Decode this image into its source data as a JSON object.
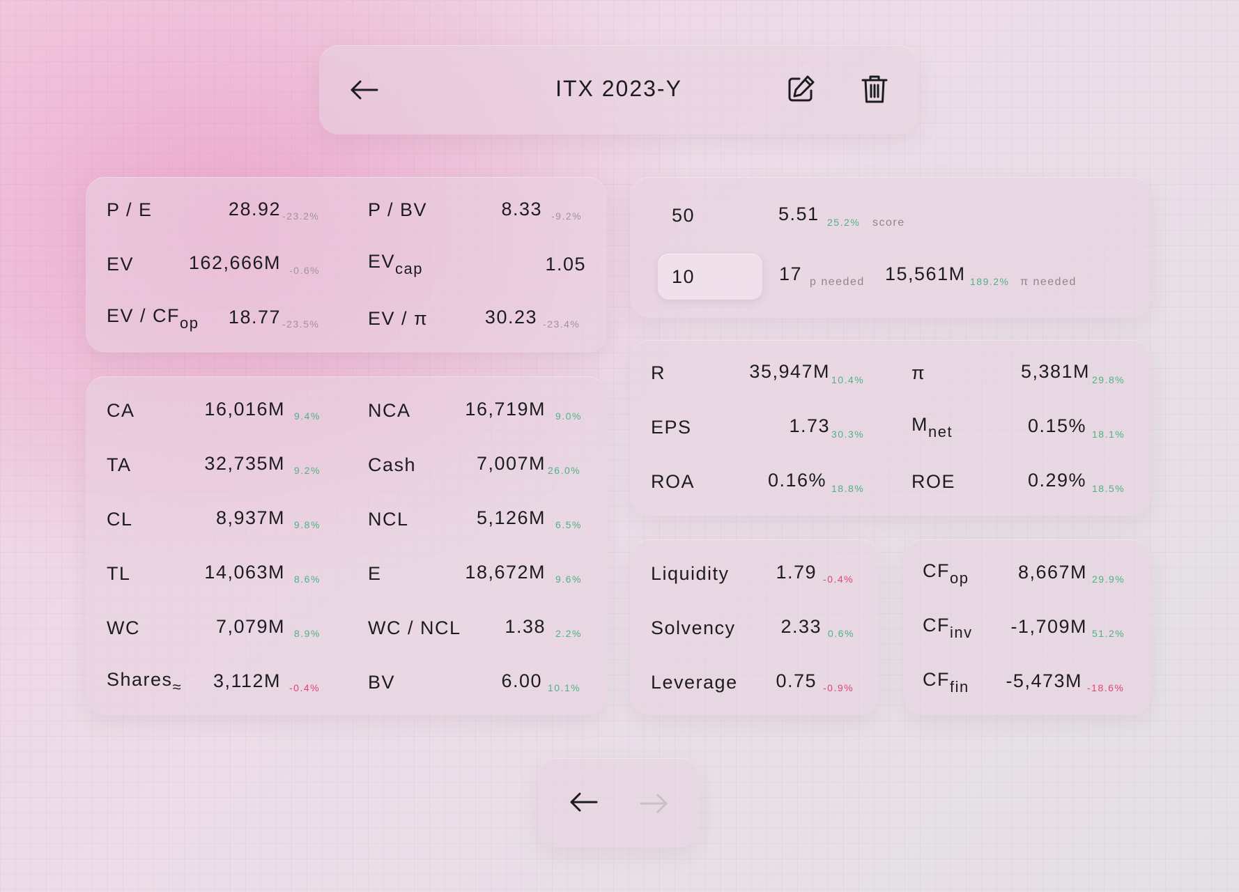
{
  "header": {
    "title": "ITX 2023-Y"
  },
  "ratios": {
    "pe": {
      "label": "P / E",
      "value": "28.92",
      "pct": "-23.2%"
    },
    "pbv": {
      "label": "P / BV",
      "value": "8.33",
      "pct": "-9.2%"
    },
    "ev": {
      "label": "EV",
      "value": "162,666M",
      "pct": "-0.6%"
    },
    "evcap": {
      "label": "EV",
      "label_sub": "cap",
      "value": "1.05"
    },
    "evcf": {
      "label": "EV / CF",
      "label_sub": "op",
      "value": "18.77",
      "pct": "-23.5%"
    },
    "evpi": {
      "label": "EV / π",
      "value": "30.23",
      "pct": "-23.4%"
    }
  },
  "balance": {
    "ca": {
      "label": "CA",
      "value": "16,016M",
      "pct": "9.4%"
    },
    "nca": {
      "label": "NCA",
      "value": "16,719M",
      "pct": "9.0%"
    },
    "ta": {
      "label": "TA",
      "value": "32,735M",
      "pct": "9.2%"
    },
    "cash": {
      "label": "Cash",
      "value": "7,007M",
      "pct": "26.0%"
    },
    "cl": {
      "label": "CL",
      "value": "8,937M",
      "pct": "9.8%"
    },
    "ncl": {
      "label": "NCL",
      "value": "5,126M",
      "pct": "6.5%"
    },
    "tl": {
      "label": "TL",
      "value": "14,063M",
      "pct": "8.6%"
    },
    "e": {
      "label": "E",
      "value": "18,672M",
      "pct": "9.6%"
    },
    "wc": {
      "label": "WC",
      "value": "7,079M",
      "pct": "8.9%"
    },
    "wcncl": {
      "label": "WC / NCL",
      "value": "1.38",
      "pct": "2.2%"
    },
    "shares": {
      "label": "Shares",
      "label_sub": "≈",
      "value": "3,112M",
      "pct": "-0.4%"
    },
    "bv": {
      "label": "BV",
      "value": "6.00",
      "pct": "10.1%"
    }
  },
  "score": {
    "input1": "50",
    "score_value": "5.51",
    "score_pct": "25.2%",
    "score_note": "score",
    "input2": "10",
    "p_needed_value": "17",
    "p_needed_note": "p needed",
    "pi_needed_value": "15,561M",
    "pi_needed_pct": "189.2%",
    "pi_needed_note": "π needed"
  },
  "income": {
    "r": {
      "label": "R",
      "value": "35,947M",
      "pct": "10.4%"
    },
    "pi": {
      "label": "π",
      "value": "5,381M",
      "pct": "29.8%"
    },
    "eps": {
      "label": "EPS",
      "value": "1.73",
      "pct": "30.3%"
    },
    "mnet": {
      "label": "M",
      "label_sub": "net",
      "value": "0.15%",
      "pct": "18.1%"
    },
    "roa": {
      "label": "ROA",
      "value": "0.16%",
      "pct": "18.8%"
    },
    "roe": {
      "label": "ROE",
      "value": "0.29%",
      "pct": "18.5%"
    }
  },
  "liquidity": {
    "liq": {
      "label": "Liquidity",
      "value": "1.79",
      "pct": "-0.4%"
    },
    "solv": {
      "label": "Solvency",
      "value": "2.33",
      "pct": "0.6%"
    },
    "lev": {
      "label": "Leverage",
      "value": "0.75",
      "pct": "-0.9%"
    }
  },
  "cashflow": {
    "op": {
      "label": "CF",
      "label_sub": "op",
      "value": "8,667M",
      "pct": "29.9%"
    },
    "inv": {
      "label": "CF",
      "label_sub": "inv",
      "value": "-1,709M",
      "pct": "51.2%"
    },
    "fin": {
      "label": "CF",
      "label_sub": "fin",
      "value": "-5,473M",
      "pct": "-18.6%"
    }
  },
  "colors": {
    "positive": "#4fb381",
    "negative": "#e0456f",
    "muted": "#9a8f96"
  },
  "icons": [
    "back-arrow-icon",
    "edit-icon",
    "trash-icon",
    "previous-arrow-icon",
    "next-arrow-icon"
  ]
}
